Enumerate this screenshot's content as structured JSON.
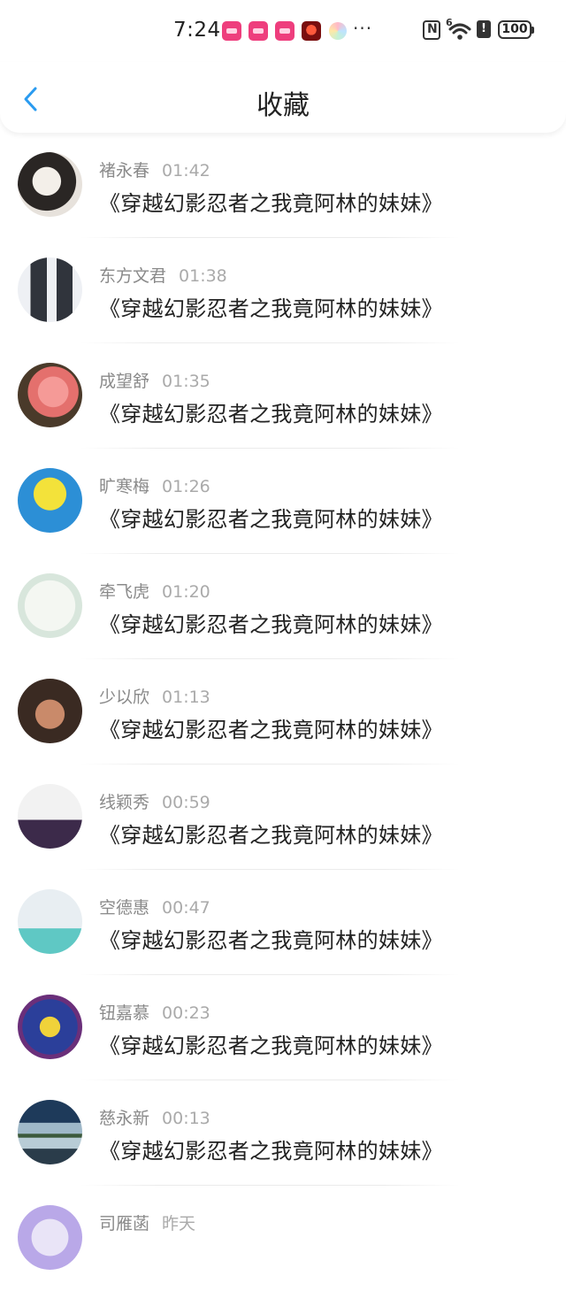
{
  "status_bar": {
    "time": "7:24",
    "more": "···",
    "signal_label": "6",
    "battery": "100",
    "icons": [
      "app-pink-icon",
      "app-pink-icon",
      "app-pink-icon",
      "game-app-icon",
      "pastel-app-icon",
      "nfc-icon",
      "wifi-icon",
      "alert-icon",
      "battery-icon"
    ]
  },
  "nav": {
    "back_icon": "chevron-left-icon",
    "title": "收藏",
    "accent": "#2a9bf0"
  },
  "items": [
    {
      "name": "褚永春",
      "time": "01:42",
      "title": "《穿越幻影忍者之我竟阿林的妹妹》"
    },
    {
      "name": "东方文君",
      "time": "01:38",
      "title": "《穿越幻影忍者之我竟阿林的妹妹》"
    },
    {
      "name": "成望舒",
      "time": "01:35",
      "title": "《穿越幻影忍者之我竟阿林的妹妹》"
    },
    {
      "name": "旷寒梅",
      "time": "01:26",
      "title": "《穿越幻影忍者之我竟阿林的妹妹》"
    },
    {
      "name": "牵飞虎",
      "time": "01:20",
      "title": "《穿越幻影忍者之我竟阿林的妹妹》"
    },
    {
      "name": "少以欣",
      "time": "01:13",
      "title": "《穿越幻影忍者之我竟阿林的妹妹》"
    },
    {
      "name": "线颖秀",
      "time": "00:59",
      "title": "《穿越幻影忍者之我竟阿林的妹妹》"
    },
    {
      "name": "空德惠",
      "time": "00:47",
      "title": "《穿越幻影忍者之我竟阿林的妹妹》"
    },
    {
      "name": "钮嘉慕",
      "time": "00:23",
      "title": "《穿越幻影忍者之我竟阿林的妹妹》"
    },
    {
      "name": "慈永新",
      "time": "00:13",
      "title": "《穿越幻影忍者之我竟阿林的妹妹》"
    },
    {
      "name": "司雁菡",
      "time": "昨天",
      "title": ""
    }
  ]
}
